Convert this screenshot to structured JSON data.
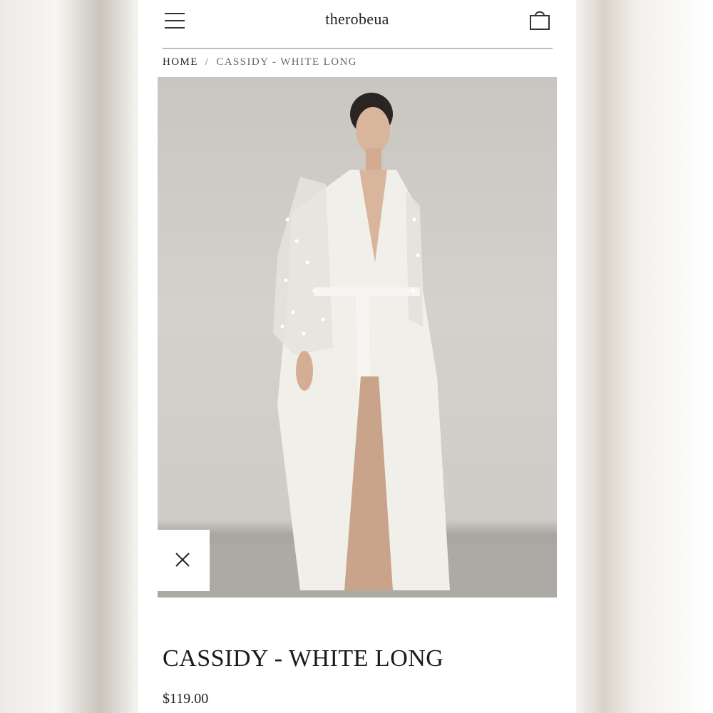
{
  "header": {
    "brand": "therobeua",
    "menu_icon": "hamburger-menu-icon",
    "cart_icon": "shopping-bag-icon"
  },
  "breadcrumb": {
    "home": "HOME",
    "separator": "/",
    "current": "CASSIDY - WHITE LONG"
  },
  "product": {
    "image_alt": "Model wearing white satin long robe with pearl-embellished sheer sleeves",
    "close_icon": "close-icon",
    "title": "CASSIDY - WHITE LONG",
    "price": "$119.00"
  },
  "colors": {
    "text": "#1a1a1a",
    "rule": "#bdbdbd",
    "background": "#ffffff"
  }
}
